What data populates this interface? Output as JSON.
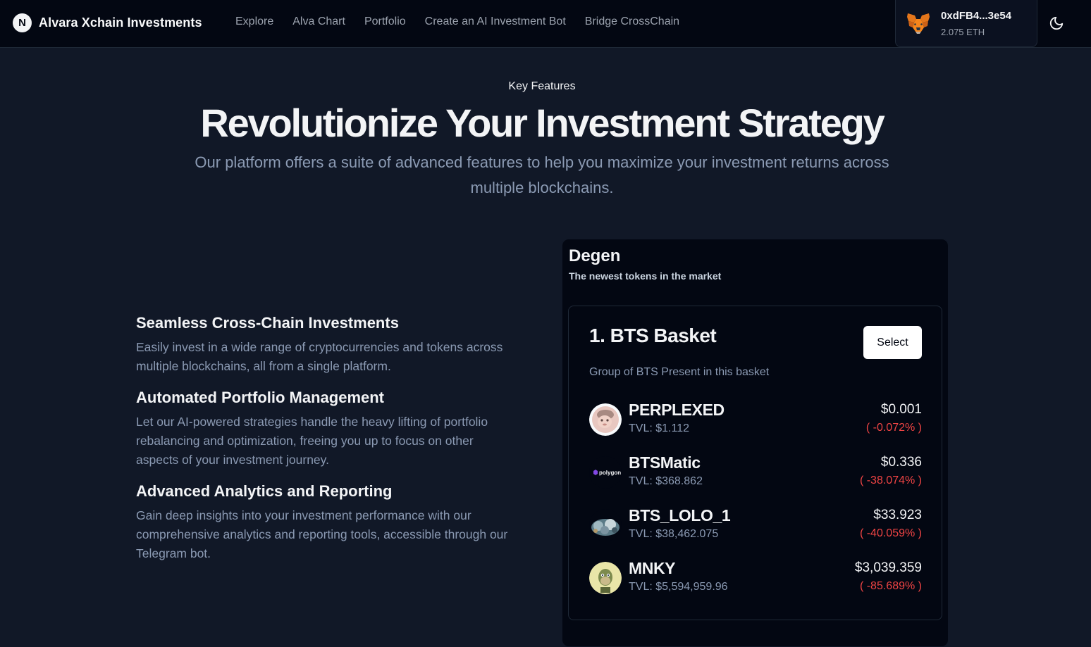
{
  "nav": {
    "brand_initial": "N",
    "brand_name": "Alvara Xchain Investments",
    "links": [
      "Explore",
      "Alva Chart",
      "Portfolio",
      "Create an AI Investment Bot",
      "Bridge CrossChain"
    ],
    "wallet_address": "0xdFB4...3e54",
    "wallet_balance": "2.075 ETH",
    "wallet_icon": "metamask-fox-icon",
    "theme_icon": "moon-icon"
  },
  "hero": {
    "kicker": "Key Features",
    "headline": "Revolutionize Your Investment Strategy",
    "subhead": "Our platform offers a suite of advanced features to help you maximize your investment returns across multiple blockchains."
  },
  "features": [
    {
      "title": "Seamless Cross-Chain Investments",
      "desc": "Easily invest in a wide range of cryptocurrencies and tokens across multiple blockchains, all from a single platform."
    },
    {
      "title": "Automated Portfolio Management",
      "desc": "Let our AI-powered strategies handle the heavy lifting of portfolio rebalancing and optimization, freeing you up to focus on other aspects of your investment journey."
    },
    {
      "title": "Advanced Analytics and Reporting",
      "desc": "Gain deep insights into your investment performance with our comprehensive analytics and reporting tools, accessible through our Telegram bot."
    }
  ],
  "degen": {
    "title": "Degen",
    "subtitle": "The newest tokens in the market",
    "basket": {
      "title": "1. BTS Basket",
      "select_label": "Select",
      "description": "Group of BTS Present in this basket",
      "tokens": [
        {
          "name": "PERPLEXED",
          "tvl": "TVL: $1.112",
          "price": "$0.001",
          "change": "( -0.072% )",
          "icon": "perplexed-token-icon"
        },
        {
          "name": "BTSMatic",
          "tvl": "TVL: $368.862",
          "price": "$0.336",
          "change": "( -38.074% )",
          "icon": "polygon-token-icon",
          "icon_text": "polygon"
        },
        {
          "name": "BTS_LOLO_1",
          "tvl": "TVL: $38,462.075",
          "price": "$33.923",
          "change": "( -40.059% )",
          "icon": "lolo-token-icon"
        },
        {
          "name": "MNKY",
          "tvl": "TVL: $5,594,959.96",
          "price": "$3,039.359",
          "change": "( -85.689% )",
          "icon": "monkey-token-icon"
        }
      ]
    }
  },
  "colors": {
    "background": "#111827",
    "navbar": "#030712",
    "card": "#030712",
    "muted_text": "#8b9ab3",
    "negative": "#ef4444",
    "accent_orange": "#f6851b"
  }
}
